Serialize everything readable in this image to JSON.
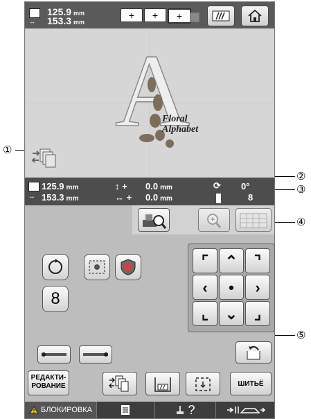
{
  "size": {
    "height_value": "125.9",
    "width_value": "153.3",
    "unit": "mm"
  },
  "frames": [
    "+",
    "+",
    "+"
  ],
  "canvas": {
    "letter": "A",
    "caption_line1": "Floral",
    "caption_line2": "Alphabet"
  },
  "info": {
    "height_value": "125.9",
    "width_value": "153.3",
    "unit": "mm",
    "v_offset_sign": "+",
    "v_offset": "0.0",
    "h_offset_sign": "+",
    "h_offset": "0.0",
    "rotation": "0°",
    "thread_count": "8"
  },
  "controls": {
    "edit_label_line1": "РЕДАКТИ-",
    "edit_label_line2": "РОВАНИЕ",
    "sew_label": "ШИТЬЁ",
    "eight_label": "8"
  },
  "bottom": {
    "lock_label": "БЛОКИРОВКА",
    "help_label": "?"
  },
  "callouts": [
    "①",
    "②",
    "③",
    "④",
    "⑤"
  ],
  "colors": {
    "topbar": "#5a5a5a",
    "panel": "#c7c7c7",
    "infobar": "#4d4d4d",
    "warning": "#e8c21c"
  }
}
